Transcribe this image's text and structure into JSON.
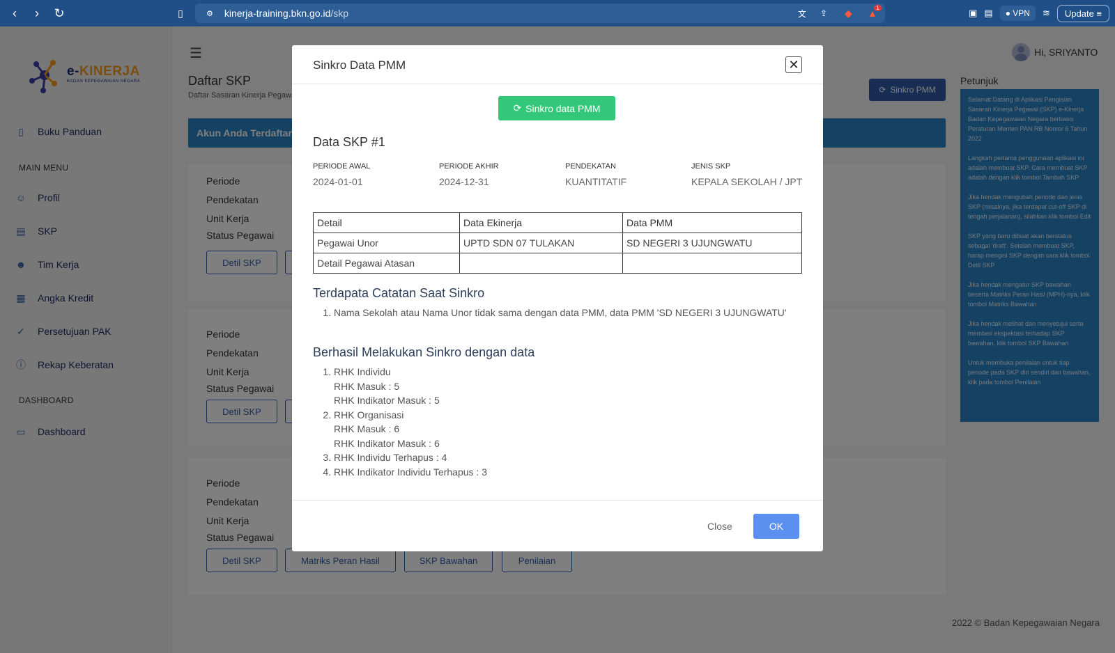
{
  "browser": {
    "url_host": "kinerja-training.bkn.go.id",
    "url_path": "/skp",
    "vpn_label": "VPN",
    "update_label": "Update",
    "notif_count": "1"
  },
  "sidebar": {
    "logo_text_a": "e-",
    "logo_text_b": "KINERJA",
    "logo_sub": "BADAN KEPEGAWAIAN NEGARA",
    "items": [
      {
        "label": "Buku Panduan"
      },
      {
        "label": "Profil"
      },
      {
        "label": "SKP"
      },
      {
        "label": "Tim Kerja"
      },
      {
        "label": "Angka Kredit"
      },
      {
        "label": "Persetujuan PAK"
      },
      {
        "label": "Rekap Keberatan"
      },
      {
        "label": "Dashboard"
      }
    ],
    "headings": {
      "main_menu": "MAIN MENU",
      "dashboard": "DASHBOARD"
    }
  },
  "header": {
    "user_greeting": "Hi, SRIYANTO",
    "page_title": "Daftar SKP",
    "page_subtitle": "Daftar Sasaran Kinerja Pegawai",
    "sinkro_pmm_label": "Sinkro PMM",
    "banner": "Akun Anda Terdaftar S"
  },
  "cards": {
    "labels": [
      "Periode",
      "Pendekatan",
      "Unit Kerja",
      "Status Pegawai"
    ],
    "buttons": [
      "Detil SKP",
      "Matriks Peran Hasil",
      "SKP Bawahan",
      "Penilaian"
    ]
  },
  "petunjuk": {
    "title": "Petunjuk",
    "paragraphs": [
      "Selamat Datang di Aplikasi Pengisian Sasaran Kinerja Pegawai (SKP) e-Kinerja Badan Kepegawaian Negara berbasis Peraturan Menteri PAN RB Nomor 6 Tahun 2022",
      "Langkah pertama penggunaan aplikasi ini adalah membuat SKP. Cara membuat SKP adalah dengan klik tombol Tambah SKP",
      "Jika hendak mengubah periode dan jenis SKP (misalnya, jika terdapat cut-off SKP di tengah perjalanan), silahkan klik tombol Edit",
      "SKP yang baru dibuat akan berstatus sebagai 'draft'. Setelah membuat SKP, harap mengisi SKP dengan cara klik tombol Detil SKP",
      "Jika hendak mengatur SKP bawahan beserta Matriks Peran Hasil (MPH)-nya, klik tombol Matriks Bawahan",
      "Jika hendak melihat dan menyetujui serta memberi ekspektasi terhadap SKP bawahan, klik tombol SKP Bawahan",
      "Untuk membuka penilaian untuk tiap periode pada SKP diri sendiri dan bawahan, klik pada tombol Penilaian"
    ]
  },
  "footer": "2022 © Badan Kepegawaian Negara",
  "modal": {
    "title": "Sinkro Data PMM",
    "sync_button": "Sinkro data PMM",
    "skp_title": "Data SKP #1",
    "fields": [
      {
        "label": "PERIODE AWAL",
        "value": "2024-01-01"
      },
      {
        "label": "PERIODE AKHIR",
        "value": "2024-12-31"
      },
      {
        "label": "PENDEKATAN",
        "value": "KUANTITATIF"
      },
      {
        "label": "JENIS SKP",
        "value": "KEPALA SEKOLAH / JPT"
      }
    ],
    "table": {
      "headers": [
        "Detail",
        "Data Ekinerja",
        "Data PMM"
      ],
      "rows": [
        [
          "Pegawai Unor",
          "UPTD SDN 07 TULAKAN",
          "SD NEGERI 3 UJUNGWATU"
        ],
        [
          "Detail Pegawai Atasan",
          "",
          ""
        ]
      ]
    },
    "notes_title": "Terdapata Catatan Saat Sinkro",
    "notes": [
      "Nama Sekolah atau Nama Unor tidak sama dengan data PMM, data PMM 'SD NEGERI 3 UJUNGWATU'"
    ],
    "success_title": "Berhasil Melakukan Sinkro dengan data",
    "success_items": [
      {
        "label": "RHK Individu",
        "subs": [
          "RHK Masuk : 5",
          "RHK Indikator Masuk : 5"
        ]
      },
      {
        "label": "RHK Organisasi",
        "subs": [
          "RHK Masuk : 6",
          "RHK Indikator Masuk : 6"
        ]
      },
      {
        "label": "RHK Individu Terhapus : 4",
        "subs": []
      },
      {
        "label": "RHK Indikator Individu Terhapus : 3",
        "subs": []
      }
    ],
    "close_label": "Close",
    "ok_label": "OK"
  }
}
